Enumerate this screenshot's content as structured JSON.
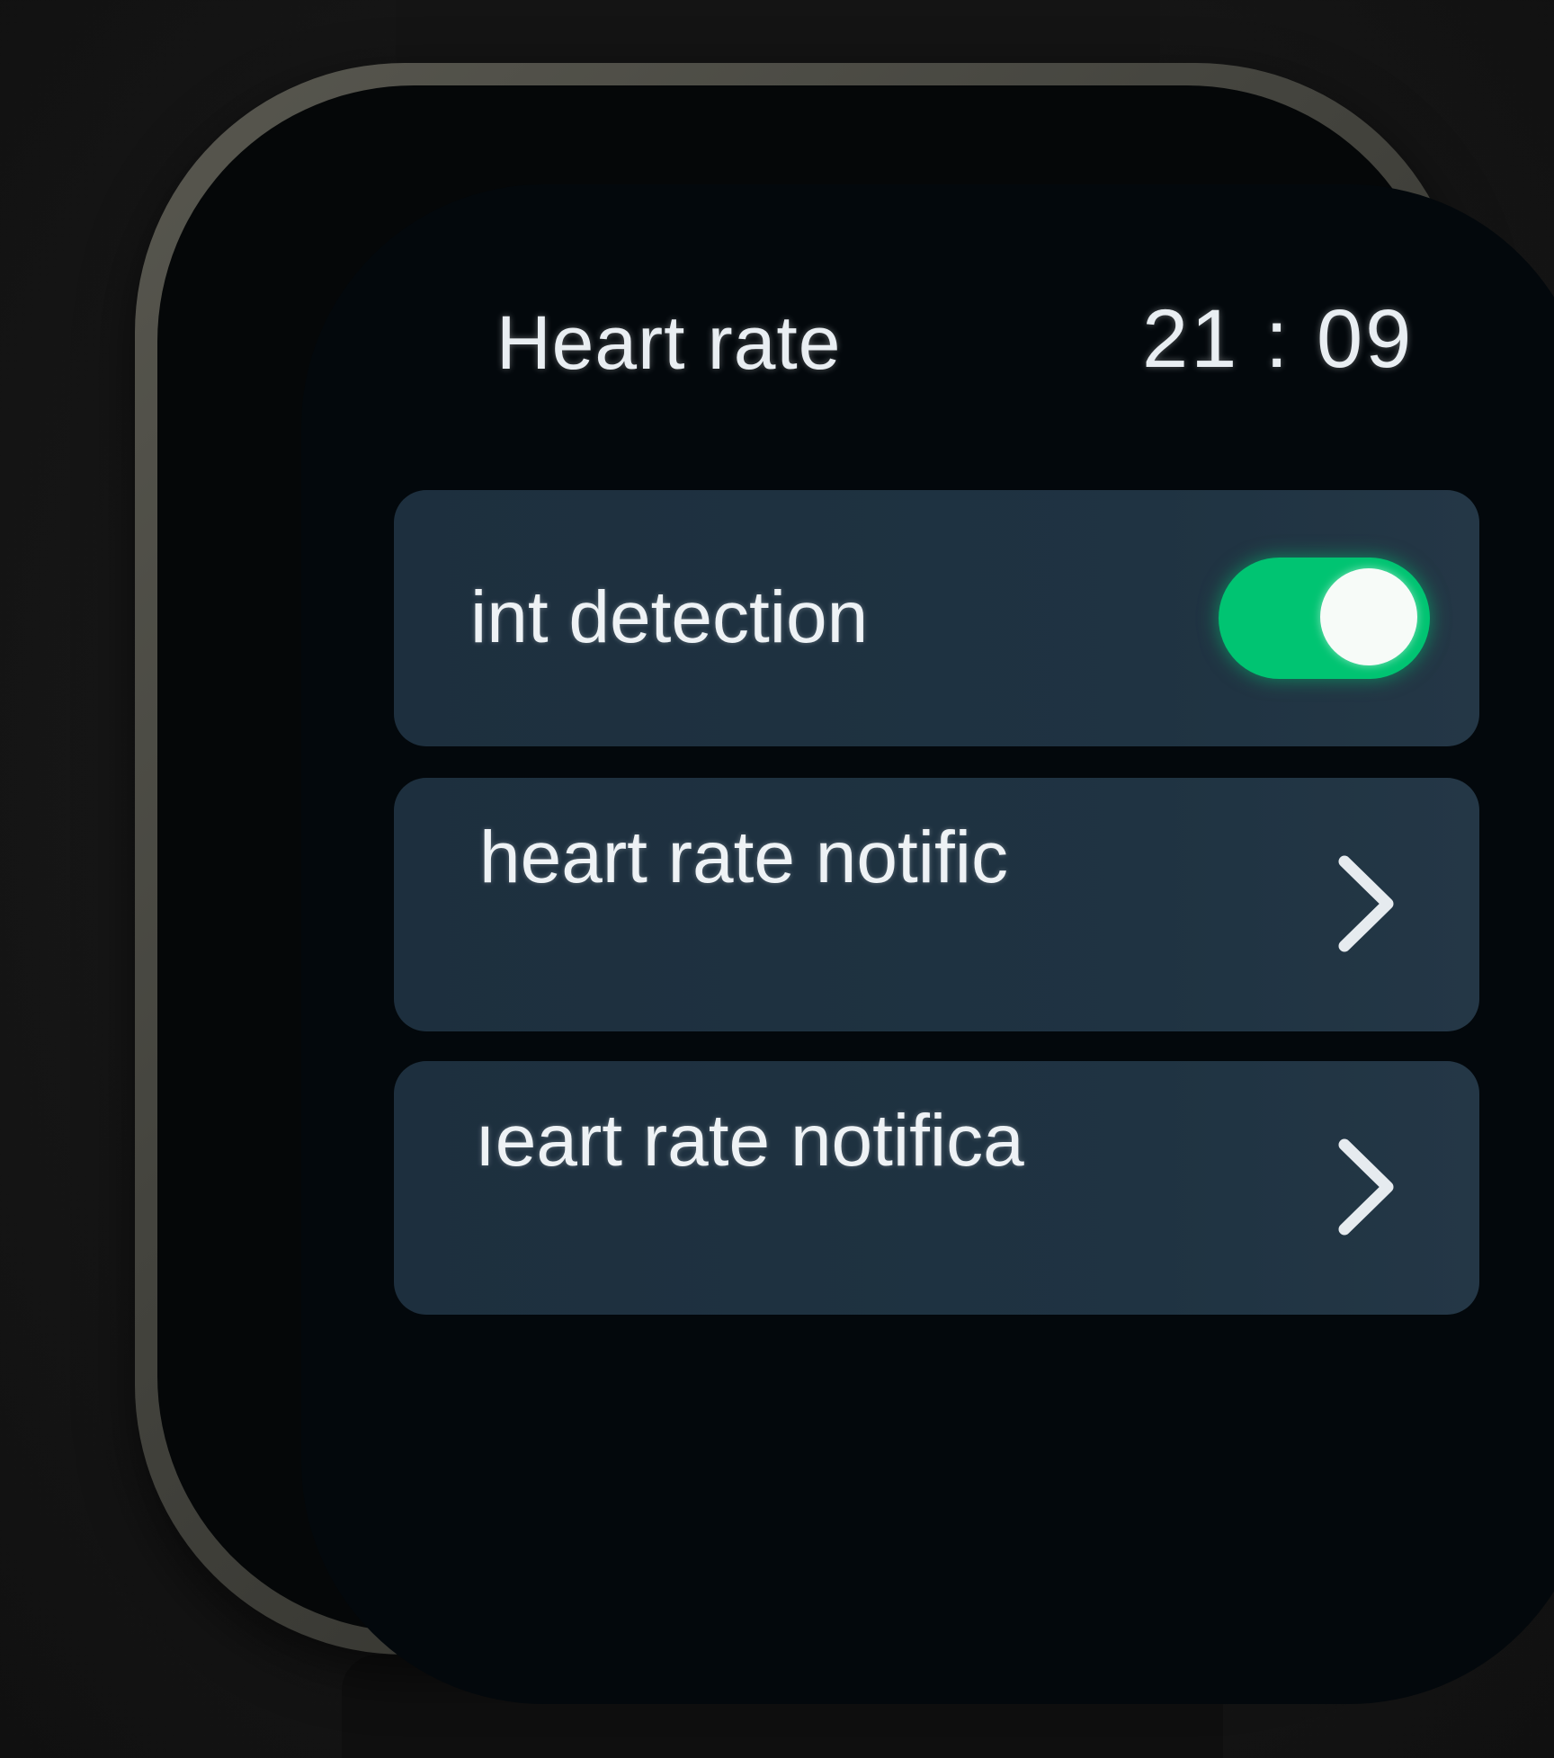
{
  "screen": {
    "title": "Heart rate",
    "time": "21 : 09"
  },
  "settings": [
    {
      "label": "int detection",
      "control": "toggle",
      "toggle_on": true,
      "accent": "#00c472"
    },
    {
      "label": "heart rate notific",
      "control": "chevron-right-icon"
    },
    {
      "label": "ıeart rate notifica",
      "control": "chevron-right-icon"
    }
  ]
}
